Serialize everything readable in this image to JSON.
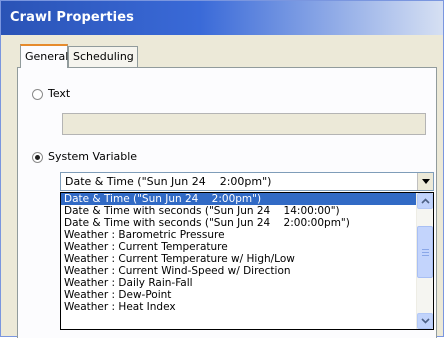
{
  "window": {
    "title": "Crawl Properties"
  },
  "tabs": [
    {
      "label": "General",
      "active": true
    },
    {
      "label": "Scheduling",
      "active": false
    }
  ],
  "options": {
    "text": {
      "label": "Text",
      "selected": false
    },
    "system_variable": {
      "label": "System Variable",
      "selected": true
    }
  },
  "text_field": {
    "value": ""
  },
  "combo": {
    "value": "Date & Time (\"Sun Jun 24    2:00pm\")"
  },
  "dropdown": {
    "items": [
      "Date & Time (\"Sun Jun 24    2:00pm\")",
      "Date & Time with seconds (\"Sun Jun 24    14:00:00\")",
      "Date & Time with seconds (\"Sun Jun 24    2:00:00pm\")",
      "Weather : Barometric Pressure",
      "Weather : Current Temperature",
      "Weather : Current Temperature w/ High/Low",
      "Weather : Current Wind-Speed w/ Direction",
      "Weather : Daily Rain-Fall",
      "Weather : Dew-Point",
      "Weather : Heat Index"
    ],
    "selected_index": 0
  },
  "colors": {
    "title_bar": "#2a53b6",
    "selection": "#316ac5",
    "tab_highlight": "#e68b2c"
  }
}
